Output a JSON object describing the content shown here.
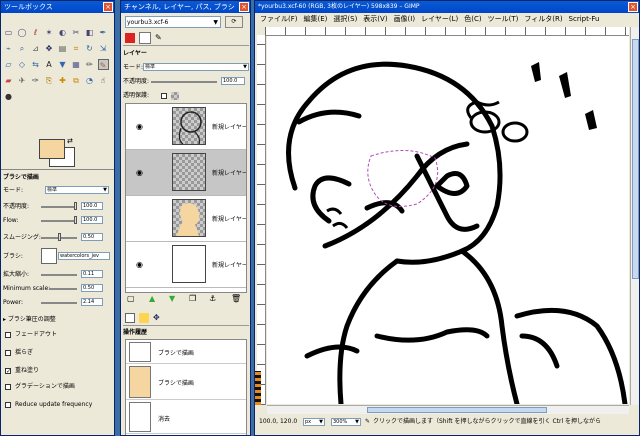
{
  "toolbox": {
    "title": "ツールボックス",
    "tool_icons": [
      "rect-select-icon",
      "ellipse-select-icon",
      "lasso-icon",
      "magic-wand-icon",
      "color-select-icon",
      "scissors-icon",
      "foreground-select-icon",
      "paths-icon",
      "color-picker-icon",
      "zoom-icon",
      "measure-icon",
      "move-icon",
      "align-icon",
      "crop-icon",
      "rotate-icon",
      "scale-icon",
      "shear-icon",
      "perspective-icon",
      "flip-icon",
      "text-icon",
      "bucket-fill-icon",
      "blend-icon",
      "pencil-icon",
      "paintbrush-icon",
      "eraser-icon",
      "airbrush-icon",
      "ink-icon",
      "clone-icon",
      "heal-icon",
      "perspective-clone-icon",
      "blur-icon",
      "smudge-icon",
      "dodge-burn-icon"
    ]
  },
  "tool_options": {
    "title": "ブラシで描画",
    "mode_label": "モード:",
    "mode_value": "標準",
    "opacity_label": "不透明度:",
    "opacity_value": "100.0",
    "opacity_fraction": 1.0,
    "flow_label": "Flow:",
    "flow_value": "100.0",
    "flow_fraction": 1.0,
    "smoothing_label": "スムージング:",
    "smoothing_value": "0.50",
    "smoothing_fraction": 0.5,
    "brush_label": "ブラシ:",
    "brush_value": "watercolors_jev",
    "scale_label": "拡大縮小:",
    "scale_value": "0.11",
    "min_scale_label": "Minimum scale:",
    "min_scale_value": "0.50",
    "power_label": "Power:",
    "power_value": "2.14",
    "expander_label": "ブラシ筆圧の調整",
    "fade_label": "フェードアウト",
    "jitter_label": "揺らぎ",
    "incremental_label": "重ね塗り",
    "gradient_label": "グラデーションで描画",
    "reduce_label": "Reduce update frequency",
    "incremental_checked": true
  },
  "layers": {
    "title": "チャンネル, レイヤー, パス, ブラシ",
    "image_name": "yourbu3.xcf-6",
    "panel_label": "レイヤー",
    "mode_label": "モード:",
    "mode_value": "標準",
    "opacity_label": "不透明度:",
    "opacity_value": "100.0",
    "lock_label": "透明保護:",
    "items": [
      {
        "name": "新規レイヤー",
        "visible": true
      },
      {
        "name": "新規レイヤー",
        "visible": true
      },
      {
        "name": "新規レイヤー",
        "visible": false
      },
      {
        "name": "新規レイヤー",
        "visible": true
      }
    ]
  },
  "undo_history": {
    "title": "操作履歴",
    "items": [
      {
        "label": "ブラシで描画"
      },
      {
        "label": "ブラシで描画"
      },
      {
        "label": "消去"
      }
    ]
  },
  "canvas_window": {
    "title": "*yourbu3.xcf-60 (RGB, 3枚のレイヤー) 598x839 – GIMP",
    "menu": [
      "ファイル(F)",
      "編集(E)",
      "選択(S)",
      "表示(V)",
      "画像(I)",
      "レイヤー(L)",
      "色(C)",
      "ツール(T)",
      "フィルタ(R)",
      "Script-Fu"
    ],
    "coords": "100.0, 120.0",
    "unit": "px",
    "zoom": "300%",
    "status": "クリックで描画します（Shift を押しながらクリックで直線を引く Ctrl を押しながら"
  }
}
